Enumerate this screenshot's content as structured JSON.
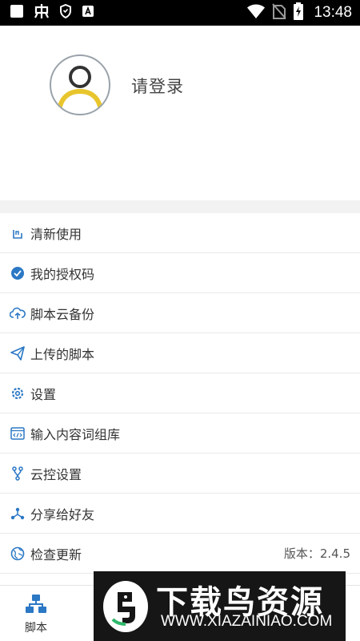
{
  "status_bar": {
    "time": "13:48",
    "icons": [
      "notification-square-icon",
      "bug-app-icon",
      "shield-icon",
      "a-app-icon",
      "wifi-icon",
      "no-sim-icon",
      "battery-charging-icon"
    ]
  },
  "profile": {
    "login_text": "请登录",
    "avatar_ring_color": "#e8c52d"
  },
  "menu": {
    "accent_color": "#2b78c5",
    "items": [
      {
        "label": "清新使用",
        "icon": "refresh-usage-icon"
      },
      {
        "label": "我的授权码",
        "icon": "authorization-badge-icon"
      },
      {
        "label": "脚本云备份",
        "icon": "cloud-backup-icon"
      },
      {
        "label": "上传的脚本",
        "icon": "paper-plane-icon"
      },
      {
        "label": "设置",
        "icon": "gear-icon"
      },
      {
        "label": "输入内容词组库",
        "icon": "code-window-icon"
      },
      {
        "label": "云控设置",
        "icon": "branch-icon"
      },
      {
        "label": "分享给好友",
        "icon": "share-icon"
      },
      {
        "label": "检查更新",
        "icon": "globe-icon",
        "value": "版本：2.4.5"
      }
    ]
  },
  "tabbar": {
    "tabs": [
      {
        "label": "脚本",
        "icon": "sitemap-icon"
      }
    ]
  },
  "watermark": {
    "title": "下载鸟资源",
    "url": "WWW.XIAZAINIAO.COM"
  }
}
